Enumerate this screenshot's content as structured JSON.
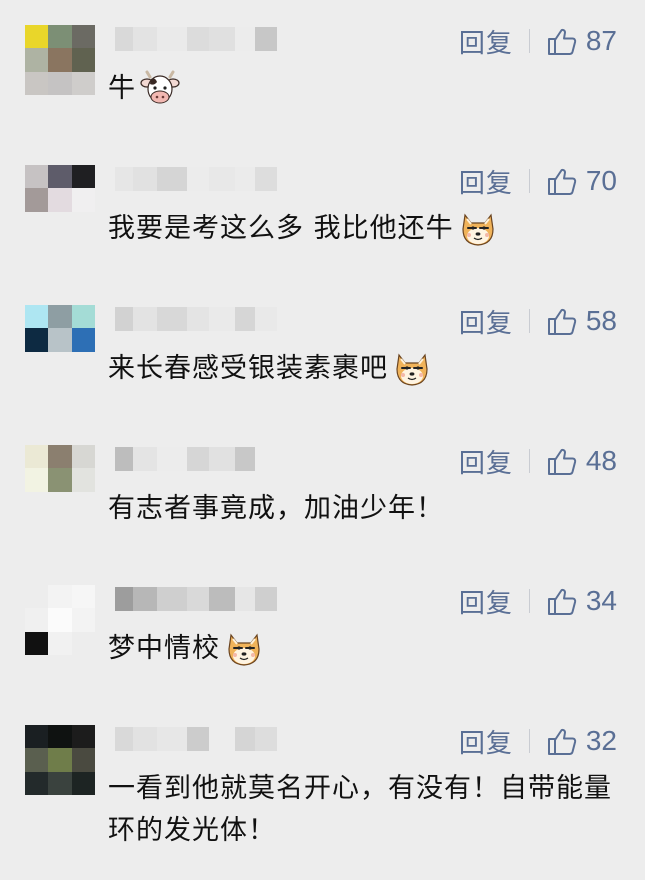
{
  "reply_label": "回复",
  "colors": {
    "link": "#5a6f95",
    "text": "#111111",
    "background": "#ededed"
  },
  "comments": [
    {
      "text": "牛",
      "emoji": "cow-face-icon",
      "likes": "87",
      "avatar_colors": [
        "#e9d62a",
        "#7c8f75",
        "#6b6a63",
        "#aeb3a3",
        "#8a7560",
        "#606250",
        "#c9c6c3",
        "#c5c3c3",
        "#cfcdcb"
      ],
      "name_blur": [
        "#d9d9d9",
        "#e3e3e3",
        "#eaeaea",
        "#dcdcdc",
        "#e0e0e0",
        "#ececec",
        "#c7c7c7"
      ]
    },
    {
      "text": "我要是考这么多 我比他还牛",
      "emoji": "doge-face-icon",
      "likes": "70",
      "avatar_colors": [
        "#c6c2c3",
        "#5e5c6a",
        "#1f1f22",
        "#a39a99",
        "#e3dbe0",
        "#f0eff0",
        "#ededed",
        "#ededed",
        "#ededed"
      ],
      "name_blur": [
        "#e6e6e6",
        "#e1e1e1",
        "#d5d5d5",
        "#ececec",
        "#e8e8e8",
        "#ebebeb",
        "#dddddd"
      ]
    },
    {
      "text": "来长春感受银装素裹吧",
      "emoji": "doge-face-icon",
      "likes": "58",
      "avatar_colors": [
        "#aee6f2",
        "#8e9ea3",
        "#a4dcd6",
        "#0d2a42",
        "#b8c3c8",
        "#2d6fb5",
        "#ededed",
        "#ededed",
        "#ededed"
      ],
      "name_blur": [
        "#d2d2d2",
        "#e3e3e3",
        "#d8d8d8",
        "#e4e4e4",
        "#eaeaea",
        "#d6d6d6",
        "#e9e9e9"
      ]
    },
    {
      "text": "有志者事竟成，加油少年！",
      "emoji": "",
      "likes": "48",
      "avatar_colors": [
        "#ebe9d5",
        "#8b7f6f",
        "#d7d7d3",
        "#f2f3e3",
        "#8a9273",
        "#e2e3df",
        "#ededed",
        "#ededed",
        "#ededed"
      ],
      "name_blur": [
        "#bdbdbd",
        "#e4e4e4",
        "#ececec",
        "#d6d6d6",
        "#e1e1e1",
        "#c8c8c8",
        "#ededed"
      ]
    },
    {
      "text": "梦中情校",
      "emoji": "doge-face-icon",
      "likes": "34",
      "avatar_colors": [
        "#ededed",
        "#f3f3f3",
        "#f6f6f6",
        "#f0f0f0",
        "#fbfbfb",
        "#f3f3f3",
        "#111111",
        "#f1f1f1",
        "#ededed"
      ],
      "name_blur": [
        "#9d9d9d",
        "#b7b7b7",
        "#cfcfcf",
        "#d9d9d9",
        "#bcbcbc",
        "#e6e6e6",
        "#cfcfcf"
      ]
    },
    {
      "text": "一看到他就莫名开心，有没有！自带能量环的发光体！",
      "emoji": "",
      "likes": "32",
      "avatar_colors": [
        "#1a1f22",
        "#0f1211",
        "#1c1c1c",
        "#5a5f4f",
        "#6f7d4a",
        "#4a4a40",
        "#232a2b",
        "#3a423e",
        "#1d2423"
      ],
      "name_blur": [
        "#d9d9d9",
        "#e2e2e2",
        "#e7e7e7",
        "#cccccc",
        "#ededed",
        "#d5d5d5",
        "#dddddd"
      ]
    }
  ]
}
